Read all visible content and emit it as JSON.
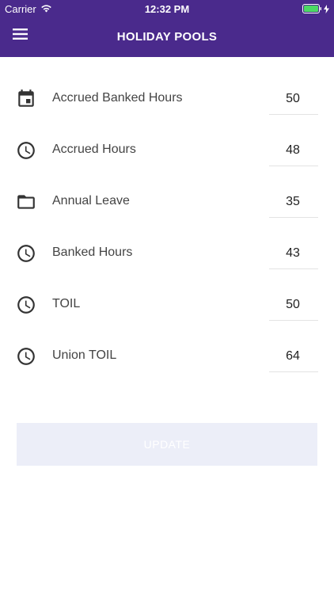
{
  "status_bar": {
    "carrier": "Carrier",
    "time": "12:32 PM"
  },
  "header": {
    "title": "HOLIDAY POOLS",
    "background_color": "#4a2a8c"
  },
  "pools": [
    {
      "label": "Accrued Banked Hours",
      "value": "50",
      "icon": "calendar-icon"
    },
    {
      "label": "Accrued Hours",
      "value": "48",
      "icon": "clock-icon"
    },
    {
      "label": "Annual Leave",
      "value": "35",
      "icon": "folder-icon"
    },
    {
      "label": "Banked Hours",
      "value": "43",
      "icon": "clock-icon"
    },
    {
      "label": "TOIL",
      "value": "50",
      "icon": "clock-icon"
    },
    {
      "label": "Union TOIL",
      "value": "64",
      "icon": "clock-icon"
    }
  ],
  "update_button": {
    "label": "UPDATE",
    "state": "disabled"
  }
}
